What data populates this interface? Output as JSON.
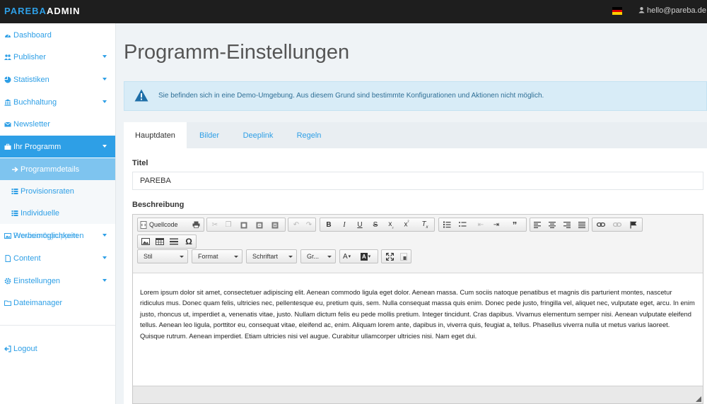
{
  "brand": {
    "part1": "PAREBA",
    "part2": "ADMIN"
  },
  "header": {
    "user_email": "hello@pareba.de",
    "flag_colors": [
      "#000000",
      "#dd0000",
      "#ffce00"
    ]
  },
  "sidebar": {
    "items": [
      {
        "label": "Dashboard",
        "icon": "dashboard-icon"
      },
      {
        "label": "Publisher",
        "icon": "users-icon"
      },
      {
        "label": "Statistiken",
        "icon": "pie-chart-icon"
      },
      {
        "label": "Buchhaltung",
        "icon": "bank-icon"
      },
      {
        "label": "Newsletter",
        "icon": "envelope-icon"
      },
      {
        "label": "Ihr Programm",
        "icon": "briefcase-icon"
      },
      {
        "label": "Programmdetails",
        "icon": "arrow-right-icon"
      },
      {
        "label": "Provisionsraten",
        "icon": "list-icon"
      },
      {
        "label": "Individuelle",
        "icon": "list-icon"
      },
      {
        "label": "Werbemöglichkeiten",
        "overlap_label": "Provisionsgruppen",
        "icon": "image-icon"
      },
      {
        "label": "Content",
        "icon": "file-icon"
      },
      {
        "label": "Einstellungen",
        "icon": "gear-icon"
      },
      {
        "label": "Dateimanager",
        "icon": "folder-icon"
      },
      {
        "label": "Logout",
        "icon": "logout-icon"
      }
    ]
  },
  "page": {
    "title": "Programm-Einstellungen"
  },
  "alert": {
    "message": "Sie befinden sich in eine Demo-Umgebung. Aus diesem Grund sind bestimmte Konfigurationen und Aktionen nicht möglich."
  },
  "tabs": [
    {
      "label": "Hauptdaten"
    },
    {
      "label": "Bilder"
    },
    {
      "label": "Deeplink"
    },
    {
      "label": "Regeln"
    }
  ],
  "form": {
    "title_label": "Titel",
    "title_value": "PAREBA",
    "description_label": "Beschreibung"
  },
  "editor": {
    "source_label": "Quellcode",
    "combos": [
      "Stil",
      "Format",
      "Schriftart",
      "Gr..."
    ],
    "text": "Lorem ipsum dolor sit amet, consectetuer adipiscing elit. Aenean commodo ligula eget dolor. Aenean massa. Cum sociis natoque penatibus et magnis dis parturient montes, nascetur ridiculus mus. Donec quam felis, ultricies nec, pellentesque eu, pretium quis, sem. Nulla consequat massa quis enim. Donec pede justo, fringilla vel, aliquet nec, vulputate eget, arcu. In enim justo, rhoncus ut, imperdiet a, venenatis vitae, justo. Nullam dictum felis eu pede mollis pretium. Integer tincidunt. Cras dapibus. Vivamus elementum semper nisi. Aenean vulputate eleifend tellus. Aenean leo ligula, porttitor eu, consequat vitae, eleifend ac, enim. Aliquam lorem ante, dapibus in, viverra quis, feugiat a, tellus. Phasellus viverra nulla ut metus varius laoreet. Quisque rutrum. Aenean imperdiet. Etiam ultricies nisi vel augue. Curabitur ullamcorper ultricies nisi. Nam eget dui."
  },
  "colors": {
    "accent": "#2e9fe6",
    "topbar": "#1e1e1e",
    "alert_bg": "#d8ecf7"
  }
}
